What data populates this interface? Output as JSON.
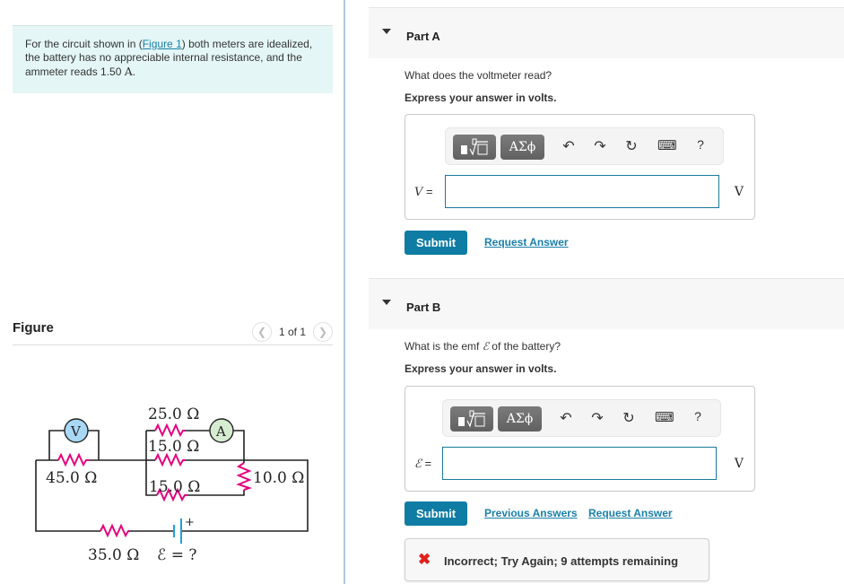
{
  "problem": {
    "text_before_link": "For the circuit shown in (",
    "link_text": "Figure 1",
    "text_after_link": ") both meters are idealized, the battery has no appreciable internal resistance, and the ammeter reads 1.50 ",
    "unit": "A",
    "end": "."
  },
  "figure": {
    "title": "Figure",
    "counter": "1 of 1",
    "prev_icon": "chevron-left",
    "next_icon": "chevron-right",
    "labels": {
      "r25": "25.0 Ω",
      "r15_top": "15.0 Ω",
      "r15_bottom": "15.0 Ω",
      "r45": "45.0 Ω",
      "r10": "10.0 Ω",
      "r35": "35.0 Ω",
      "emf": "ℰ = ?",
      "voltmeter": "V",
      "ammeter": "A",
      "battery_plus": "+"
    },
    "colors": {
      "wire": "#222222",
      "resistor": "#e5007e",
      "battery": "#1fa0d8",
      "voltmeter_fill": "#a9d8f5",
      "ammeter_fill": "#d6ecd0"
    }
  },
  "parts": [
    {
      "title": "Part A",
      "question": "What does the voltmeter read?",
      "instruction": "Express your answer in volts.",
      "variable": "V",
      "equals": "=",
      "input_value": "",
      "unit": "V",
      "submit_label": "Submit",
      "links": [
        "Request Answer"
      ]
    },
    {
      "title": "Part B",
      "question_before": "What is the emf ",
      "question_symbol": "ℰ",
      "question_after": " of the battery?",
      "instruction": "Express your answer in volts.",
      "variable": "ℰ",
      "equals": "=",
      "input_value": "",
      "unit": "V",
      "submit_label": "Submit",
      "links": [
        "Previous Answers",
        "Request Answer"
      ],
      "feedback": "Incorrect; Try Again; 9 attempts remaining"
    }
  ],
  "toolbar": {
    "template_label": "▪√□",
    "greek_label": "ΑΣϕ",
    "undo": "↶",
    "redo": "↷",
    "reset": "↻",
    "keyboard": "⌨",
    "help": "?"
  },
  "colors": {
    "accent": "#0f7ca4",
    "link": "#1a7fa8",
    "problem_bg": "#e4f6f6",
    "error": "#e0201c"
  }
}
